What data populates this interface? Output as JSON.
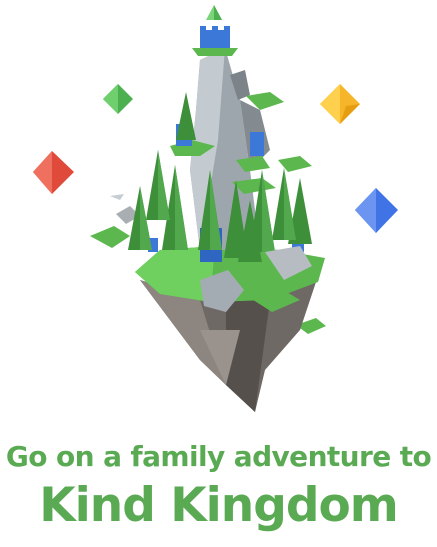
{
  "headline": {
    "line1": "Go on a family adventure to",
    "line2": "Kind Kingdom"
  },
  "colors": {
    "text": "#5aaa54",
    "grass": "#5cb84e",
    "grass_dark": "#3d8f3a",
    "rock": "#8a8a8a",
    "rock_dark": "#5e5a57",
    "castle_blue": "#3b78d8",
    "gem_red": "#e04a3a",
    "gem_yellow": "#f7b529",
    "gem_blue": "#3f73e6",
    "gem_green": "#4caf50"
  },
  "icons": [
    "floating-island-illustration",
    "red-gem-icon",
    "green-gem-icon",
    "yellow-gem-icon",
    "blue-gem-icon",
    "top-green-gem-icon"
  ]
}
